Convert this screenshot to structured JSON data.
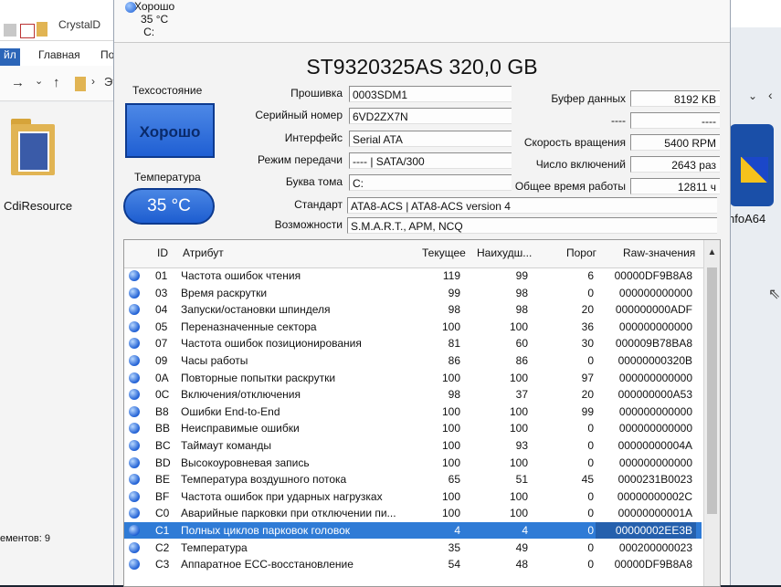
{
  "explorer": {
    "tab_title": "CrystalD",
    "ribbon": {
      "file": "йл",
      "home": "Главная",
      "share": "По"
    },
    "path_fragment": "Эт",
    "folder_label": "CdiResource",
    "status_count": "ементов: 9",
    "right_label": "nfoA64"
  },
  "cdi": {
    "status_mini": {
      "label": "Хорошо",
      "temp": "35 °C",
      "drive": "C:"
    },
    "disk_title": "ST9320325AS 320,0 GB",
    "health_label": "Техсостояние",
    "health_value": "Хорошо",
    "temp_label": "Температура",
    "temp_value": "35 °C",
    "left_fields": [
      {
        "label": "Прошивка",
        "value": "0003SDM1"
      },
      {
        "label": "Серийный номер",
        "value": "6VD2ZX7N"
      },
      {
        "label": "Интерфейс",
        "value": "Serial ATA"
      },
      {
        "label": "Режим передачи",
        "value": "---- | SATA/300"
      },
      {
        "label": "Буква тома",
        "value": "C:"
      },
      {
        "label": "Стандарт",
        "value": "ATA8-ACS | ATA8-ACS version 4"
      },
      {
        "label": "Возможности",
        "value": "S.M.A.R.T., APM, NCQ"
      }
    ],
    "right_fields": [
      {
        "label": "Буфер данных",
        "value": "8192 KB"
      },
      {
        "label": "----",
        "value": "----"
      },
      {
        "label": "Скорость вращения",
        "value": "5400 RPM"
      },
      {
        "label": "Число включений",
        "value": "2643 раз"
      },
      {
        "label": "Общее время работы",
        "value": "12811 ч"
      }
    ],
    "table": {
      "headers": {
        "id": "ID",
        "attr": "Атрибут",
        "current": "Текущее",
        "worst": "Наихудш...",
        "threshold": "Порог",
        "raw": "Raw-значения"
      },
      "rows": [
        {
          "id": "01",
          "name": "Частота ошибок чтения",
          "cur": "119",
          "worst": "99",
          "thr": "6",
          "raw": "00000DF9B8A8"
        },
        {
          "id": "03",
          "name": "Время раскрутки",
          "cur": "99",
          "worst": "98",
          "thr": "0",
          "raw": "000000000000"
        },
        {
          "id": "04",
          "name": "Запуски/остановки шпинделя",
          "cur": "98",
          "worst": "98",
          "thr": "20",
          "raw": "000000000ADF"
        },
        {
          "id": "05",
          "name": "Переназначенные сектора",
          "cur": "100",
          "worst": "100",
          "thr": "36",
          "raw": "000000000000"
        },
        {
          "id": "07",
          "name": "Частота ошибок позиционирования",
          "cur": "81",
          "worst": "60",
          "thr": "30",
          "raw": "000009B78BA8"
        },
        {
          "id": "09",
          "name": "Часы работы",
          "cur": "86",
          "worst": "86",
          "thr": "0",
          "raw": "00000000320B"
        },
        {
          "id": "0A",
          "name": "Повторные попытки раскрутки",
          "cur": "100",
          "worst": "100",
          "thr": "97",
          "raw": "000000000000"
        },
        {
          "id": "0C",
          "name": "Включения/отключения",
          "cur": "98",
          "worst": "37",
          "thr": "20",
          "raw": "000000000A53"
        },
        {
          "id": "B8",
          "name": "Ошибки End-to-End",
          "cur": "100",
          "worst": "100",
          "thr": "99",
          "raw": "000000000000"
        },
        {
          "id": "BB",
          "name": "Неисправимые ошибки",
          "cur": "100",
          "worst": "100",
          "thr": "0",
          "raw": "000000000000"
        },
        {
          "id": "BC",
          "name": "Таймаут команды",
          "cur": "100",
          "worst": "93",
          "thr": "0",
          "raw": "00000000004A"
        },
        {
          "id": "BD",
          "name": "Высокоуровневая запись",
          "cur": "100",
          "worst": "100",
          "thr": "0",
          "raw": "000000000000"
        },
        {
          "id": "BE",
          "name": "Температура воздушного потока",
          "cur": "65",
          "worst": "51",
          "thr": "45",
          "raw": "0000231B0023"
        },
        {
          "id": "BF",
          "name": "Частота ошибок при ударных нагрузках",
          "cur": "100",
          "worst": "100",
          "thr": "0",
          "raw": "00000000002C"
        },
        {
          "id": "C0",
          "name": "Аварийные парковки при отключении пи...",
          "cur": "100",
          "worst": "100",
          "thr": "0",
          "raw": "00000000001A"
        },
        {
          "id": "C1",
          "name": "Полных циклов парковок головок",
          "cur": "4",
          "worst": "4",
          "thr": "0",
          "raw": "00000002EE3B",
          "selected": true
        },
        {
          "id": "C2",
          "name": "Температура",
          "cur": "35",
          "worst": "49",
          "thr": "0",
          "raw": "000200000023"
        },
        {
          "id": "C3",
          "name": "Аппаратное ECC-восстановление",
          "cur": "54",
          "worst": "48",
          "thr": "0",
          "raw": "00000DF9B8A8"
        }
      ]
    }
  }
}
